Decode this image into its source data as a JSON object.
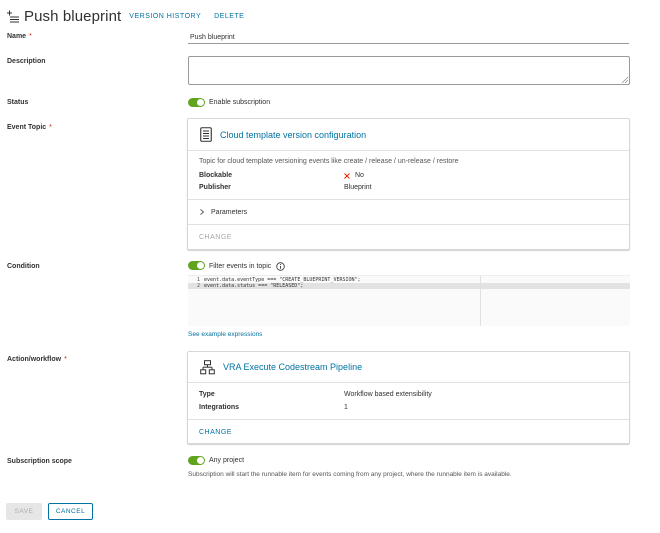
{
  "header": {
    "title": "Push blueprint",
    "version_history": "VERSION HISTORY",
    "delete": "DELETE",
    "icon": "subscription-icon"
  },
  "form": {
    "name_label": "Name",
    "name_value": "Push blueprint",
    "description_label": "Description",
    "description_value": "",
    "required_mark": "*",
    "status_label": "Status",
    "status_toggle_label": "Enable subscription",
    "event_topic_label": "Event Topic",
    "condition_label": "Condition",
    "action_label": "Action/workflow",
    "scope_label": "Subscription scope"
  },
  "event_topic": {
    "title": "Cloud template version configuration",
    "icon": "document-icon",
    "description": "Topic for cloud template versioning events like create / release / un-release / restore",
    "blockable_label": "Blockable",
    "blockable_value": "No",
    "blockable_icon": "x-icon",
    "publisher_label": "Publisher",
    "publisher_value": "Blueprint",
    "parameters_label": "Parameters",
    "change_label": "CHANGE"
  },
  "condition": {
    "toggle_label": "Filter events in topic",
    "info_icon": "info-icon",
    "lines": [
      {
        "num": "1",
        "code": "event.data.eventType === \"CREATE_BLUEPRINT_VERSION\";"
      },
      {
        "num": "2",
        "code": "event.data.status === \"RELEASED\";"
      }
    ],
    "example_link": "See example expressions"
  },
  "action": {
    "title": "VRA Execute Codestream Pipeline",
    "icon": "workflow-icon",
    "type_label": "Type",
    "type_value": "Workflow based extensibility",
    "integrations_label": "Integrations",
    "integrations_value": "1",
    "change_label": "CHANGE"
  },
  "scope": {
    "toggle_label": "Any project",
    "help": "Subscription will start the runnable item for events coming from any project, where the runnable item is available."
  },
  "buttons": {
    "save": "SAVE",
    "cancel": "CANCEL"
  },
  "colors": {
    "accent": "#0072a3",
    "toggle_on": "#62a420",
    "required": "#c92100",
    "error_x": "#e12200"
  }
}
